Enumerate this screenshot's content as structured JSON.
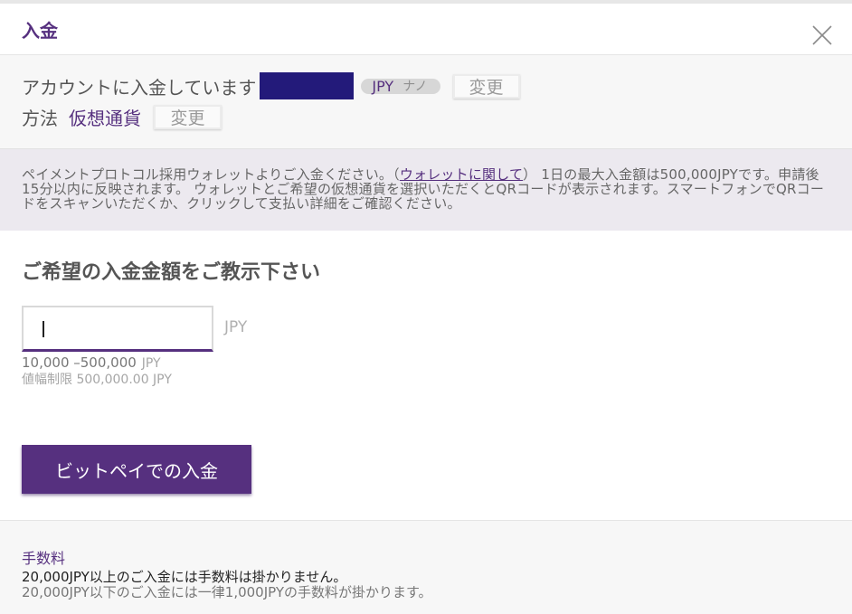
{
  "header": {
    "title": "入金"
  },
  "account": {
    "label": "アカウントに入金しています",
    "currency": "JPY",
    "currency_sub": "ナノ",
    "change_label": "変更"
  },
  "method": {
    "label": "方法",
    "value": "仮想通貨",
    "change_label": "変更"
  },
  "info": {
    "part1": "ペイメントプロトコル採用ウォレットよりご入金ください。（",
    "link": "ウォレットに関して",
    "part2": "） 1日の最大入金額は500,000JPYです。申請後15分以内に反映されます。 ウォレットとご希望の仮想通貨を選択いただくとQRコードが表示されます。スマートフォンでQRコードをスキャンいただくか、クリックして支払い詳細をご確認ください。"
  },
  "amount": {
    "heading": "ご希望の入金金額をご教示下さい",
    "value": "",
    "unit": "JPY",
    "range": "10,000 –500,000",
    "range_unit": "JPY",
    "limit": "値幅制限 500,000.00 JPY"
  },
  "submit_label": "ビットペイでの入金",
  "fees": {
    "title": "手数料",
    "line1": "20,000JPY以上のご入金には手数料は掛かりません。",
    "line2": "20,000JPY以下のご入金には一律1,000JPYの手数料が掛かります。"
  },
  "colors": {
    "accent": "#56307f",
    "masked_account": "#231a7a",
    "info_bg": "#ece9ef"
  },
  "icons": {
    "close": "close-icon"
  }
}
